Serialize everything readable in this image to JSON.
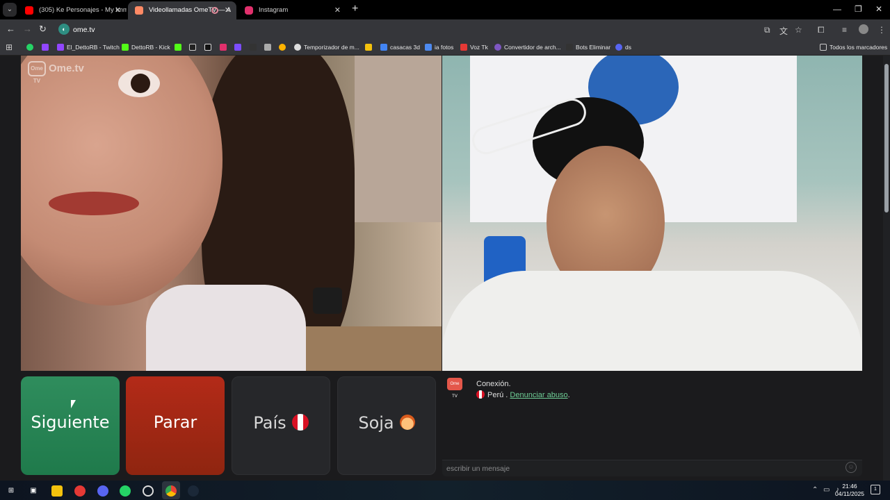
{
  "browser": {
    "tabs": [
      {
        "title": "(305) Ke Personajes - My Immo",
        "favicon_color": "#ff0000",
        "active": false
      },
      {
        "title": "Videollamadas OmeTV — A",
        "favicon_color": "#ff8a65",
        "active": true,
        "recording": true
      },
      {
        "title": "Instagram",
        "favicon_color": "#e1306c",
        "active": false
      }
    ],
    "url": "ome.tv",
    "bookmarks": [
      {
        "label": "",
        "icon": "whatsapp-icon",
        "color": "#25d366"
      },
      {
        "label": "",
        "icon": "twitch-icon",
        "color": "#9146ff"
      },
      {
        "label": "El_DettoRB - Twitch",
        "icon": "twitch-icon",
        "color": "#9146ff"
      },
      {
        "label": "DettoRB - Kick",
        "icon": "kick-icon",
        "color": "#53fc18"
      },
      {
        "label": "",
        "icon": "kick-icon",
        "color": "#53fc18"
      },
      {
        "label": "",
        "icon": "tiktok-icon",
        "color": "#ffffff"
      },
      {
        "label": "",
        "icon": "x-icon",
        "color": "#ffffff"
      },
      {
        "label": "",
        "icon": "instagram-icon",
        "color": "#e1306c"
      },
      {
        "label": "",
        "icon": "app-icon",
        "color": "#7c4dff"
      },
      {
        "label": "",
        "icon": "app-icon",
        "color": "#333333"
      },
      {
        "label": "",
        "icon": "puzzle-icon",
        "color": "#aaaaaa"
      },
      {
        "label": "",
        "icon": "app-icon",
        "color": "#ffb300"
      },
      {
        "label": "Temporizador de m...",
        "icon": "timer-icon",
        "color": "#dddddd"
      },
      {
        "label": "",
        "icon": "folder-icon",
        "color": "#f4c20d"
      },
      {
        "label": "casacas 3d",
        "icon": "image-icon",
        "color": "#4285f4"
      },
      {
        "label": "ia fotos",
        "icon": "ai-icon",
        "color": "#4d8af0"
      },
      {
        "label": "Voz Tk",
        "icon": "voice-icon",
        "color": "#e53935"
      },
      {
        "label": "Convertidor de arch...",
        "icon": "convert-icon",
        "color": "#7e57c2"
      },
      {
        "label": "Bots Eliminar",
        "icon": "bot-icon",
        "color": "#333333"
      },
      {
        "label": "ds",
        "icon": "discord-icon",
        "color": "#5865f2"
      }
    ],
    "all_bookmarks": "Todos los marcadores"
  },
  "page": {
    "logo_text": "Ome.tv",
    "logo_badge": "Ome TV",
    "buttons": {
      "next": "Siguiente",
      "stop": "Parar",
      "country": "País",
      "gender": "Soja"
    },
    "chat": {
      "logo_badge": "Ome TV",
      "connection": "Conexión.",
      "country": "Perú",
      "separator": " . ",
      "report": "Denunciar abuso",
      "report_suffix": ".",
      "placeholder": "escribir un mensaje"
    },
    "colors": {
      "next": "#2f8d5d",
      "stop": "#b32a18",
      "link": "#6fcf97"
    }
  },
  "taskbar": {
    "time": "21:46",
    "date": "04/11/2025",
    "notifications": "1"
  }
}
